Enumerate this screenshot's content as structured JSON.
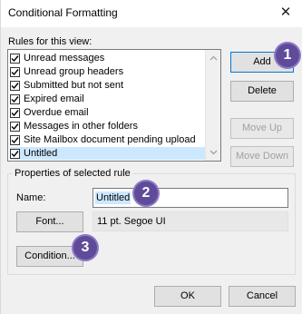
{
  "window": {
    "title": "Conditional Formatting"
  },
  "rules": {
    "label": "Rules for this view:",
    "items": [
      {
        "label": "Unread messages",
        "checked": true
      },
      {
        "label": "Unread group headers",
        "checked": true
      },
      {
        "label": "Submitted but not sent",
        "checked": true
      },
      {
        "label": "Expired email",
        "checked": true
      },
      {
        "label": "Overdue email",
        "checked": true
      },
      {
        "label": "Messages in other folders",
        "checked": true
      },
      {
        "label": "Site Mailbox document pending upload",
        "checked": true
      },
      {
        "label": "Untitled",
        "checked": true,
        "selected": true
      }
    ]
  },
  "buttons": {
    "add": "Add",
    "delete": "Delete",
    "move_up": "Move Up",
    "move_down": "Move Down",
    "font": "Font...",
    "condition": "Condition...",
    "ok": "OK",
    "cancel": "Cancel"
  },
  "properties": {
    "group_label": "Properties of selected rule",
    "name_label": "Name:",
    "name_value": "Untitled",
    "font_info": "11 pt. Segoe UI"
  },
  "badges": [
    "1",
    "2",
    "3"
  ],
  "colors": {
    "selection": "#cce8ff",
    "badge": "#5f4b99",
    "primary_border": "#0078d7"
  }
}
